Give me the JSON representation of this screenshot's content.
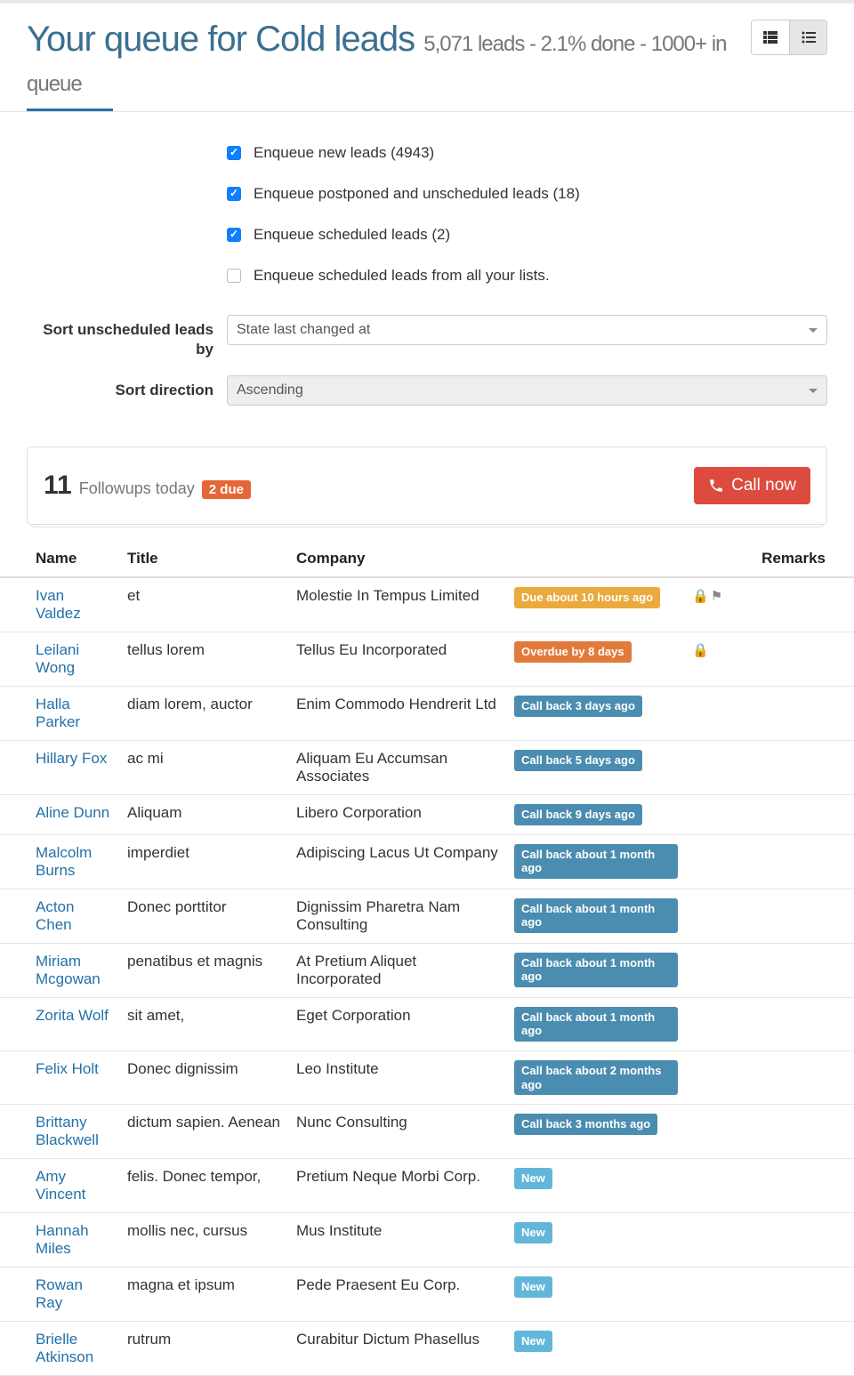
{
  "header": {
    "title_prefix": "Your queue for ",
    "title_name": "Cold leads",
    "subtitle": "5,071 leads - 2.1% done - 1000+ in queue"
  },
  "filters": {
    "checkboxes": [
      {
        "label": "Enqueue new leads (4943)",
        "checked": true
      },
      {
        "label": "Enqueue postponed and unscheduled leads (18)",
        "checked": true
      },
      {
        "label": "Enqueue scheduled leads (2)",
        "checked": true
      },
      {
        "label": "Enqueue scheduled leads from all your lists.",
        "checked": false
      }
    ],
    "sort_by_label": "Sort unscheduled leads by",
    "sort_by_value": "State last changed at",
    "sort_dir_label": "Sort direction",
    "sort_dir_value": "Ascending"
  },
  "followups": {
    "count": "11",
    "label": "Followups today",
    "due_badge": "2 due",
    "call_btn": "Call now"
  },
  "table": {
    "headers": {
      "name": "Name",
      "title": "Title",
      "company": "Company",
      "remarks": "Remarks"
    },
    "rows": [
      {
        "name": "Ivan Valdez",
        "title": "et",
        "company": "Molestie In Tempus Limited",
        "status": "Due about 10 hours ago",
        "status_type": "warn",
        "lock": true,
        "flag": true
      },
      {
        "name": "Leilani Wong",
        "title": "tellus lorem",
        "company": "Tellus Eu Incorporated",
        "status": "Overdue by 8 days",
        "status_type": "over",
        "lock": true,
        "flag": false
      },
      {
        "name": "Halla Parker",
        "title": "diam lorem, auctor",
        "company": "Enim Commodo Hendrerit Ltd",
        "status": "Call back 3 days ago",
        "status_type": "call"
      },
      {
        "name": "Hillary Fox",
        "title": "ac mi",
        "company": "Aliquam Eu Accumsan Associates",
        "status": "Call back 5 days ago",
        "status_type": "call"
      },
      {
        "name": "Aline Dunn",
        "title": "Aliquam",
        "company": "Libero Corporation",
        "status": "Call back 9 days ago",
        "status_type": "call"
      },
      {
        "name": "Malcolm Burns",
        "title": "imperdiet",
        "company": "Adipiscing Lacus Ut Company",
        "status": "Call back about 1 month ago",
        "status_type": "call"
      },
      {
        "name": "Acton Chen",
        "title": "Donec porttitor",
        "company": "Dignissim Pharetra Nam Consulting",
        "status": "Call back about 1 month ago",
        "status_type": "call"
      },
      {
        "name": "Miriam Mcgowan",
        "title": "penatibus et magnis",
        "company": "At Pretium Aliquet Incorporated",
        "status": "Call back about 1 month ago",
        "status_type": "call"
      },
      {
        "name": "Zorita Wolf",
        "title": "sit amet,",
        "company": "Eget Corporation",
        "status": "Call back about 1 month ago",
        "status_type": "call"
      },
      {
        "name": "Felix Holt",
        "title": "Donec dignissim",
        "company": "Leo Institute",
        "status": "Call back about 2 months ago",
        "status_type": "call"
      },
      {
        "name": "Brittany Blackwell",
        "title": "dictum sapien. Aenean",
        "company": "Nunc Consulting",
        "status": "Call back 3 months ago",
        "status_type": "call"
      },
      {
        "name": "Amy Vincent",
        "title": "felis. Donec tempor,",
        "company": "Pretium Neque Morbi Corp.",
        "status": "New",
        "status_type": "new"
      },
      {
        "name": "Hannah Miles",
        "title": "mollis nec, cursus",
        "company": "Mus Institute",
        "status": "New",
        "status_type": "new"
      },
      {
        "name": "Rowan Ray",
        "title": "magna et ipsum",
        "company": "Pede Praesent Eu Corp.",
        "status": "New",
        "status_type": "new"
      },
      {
        "name": "Brielle Atkinson",
        "title": "rutrum",
        "company": "Curabitur Dictum Phasellus",
        "status": "New",
        "status_type": "new"
      }
    ]
  }
}
